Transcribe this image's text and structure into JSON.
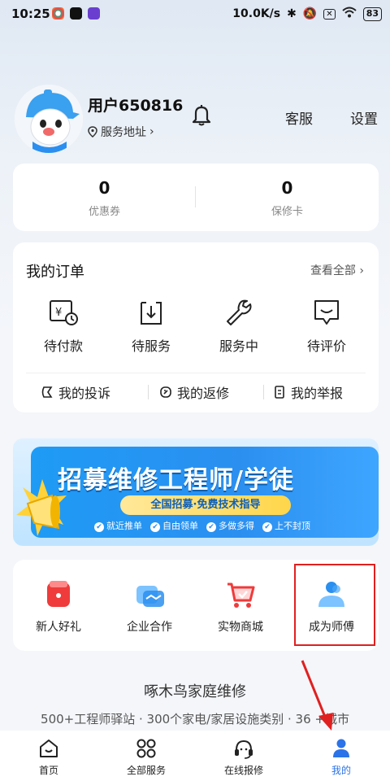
{
  "status_bar": {
    "time": "10:25",
    "net_speed": "10.0K/s",
    "battery": "83"
  },
  "profile": {
    "username": "用户650816",
    "address_link": "服务地址",
    "service_link": "客服",
    "settings_link": "设置"
  },
  "stats": [
    {
      "value": "0",
      "label": "优惠券"
    },
    {
      "value": "0",
      "label": "保修卡"
    }
  ],
  "orders": {
    "title": "我的订单",
    "view_all": "查看全部",
    "items": [
      {
        "label": "待付款",
        "icon": "payment-icon"
      },
      {
        "label": "待服务",
        "icon": "pending-service-icon"
      },
      {
        "label": "服务中",
        "icon": "wrench-icon"
      },
      {
        "label": "待评价",
        "icon": "review-icon"
      }
    ],
    "sub_links": [
      {
        "label": "我的投诉",
        "icon": "complaint-icon"
      },
      {
        "label": "我的返修",
        "icon": "rework-icon"
      },
      {
        "label": "我的举报",
        "icon": "report-icon"
      }
    ]
  },
  "banner": {
    "title": "招募维修工程师/学徒",
    "pill": "全国招募·免费技术指导",
    "tags": [
      "就近推单",
      "自由领单",
      "多做多得",
      "上不封顶"
    ]
  },
  "shortcuts": [
    {
      "label": "新人好礼",
      "icon": "gift-icon"
    },
    {
      "label": "企业合作",
      "icon": "handshake-icon"
    },
    {
      "label": "实物商城",
      "icon": "cart-icon"
    },
    {
      "label": "成为师傅",
      "icon": "user-icon"
    }
  ],
  "footer": {
    "title": "啄木鸟家庭维修",
    "subtitle": "500+工程师驿站 · 300个家电/家居设施类别 · 36 +城市"
  },
  "bottom_nav": [
    {
      "label": "首页",
      "icon": "home-icon"
    },
    {
      "label": "全部服务",
      "icon": "grid-icon"
    },
    {
      "label": "在线报修",
      "icon": "headset-icon"
    },
    {
      "label": "我的",
      "icon": "profile-icon",
      "active": true
    }
  ],
  "colors": {
    "accent": "#2b73e8",
    "highlight": "#e02020",
    "banner_blue": "#2b8ff0"
  }
}
